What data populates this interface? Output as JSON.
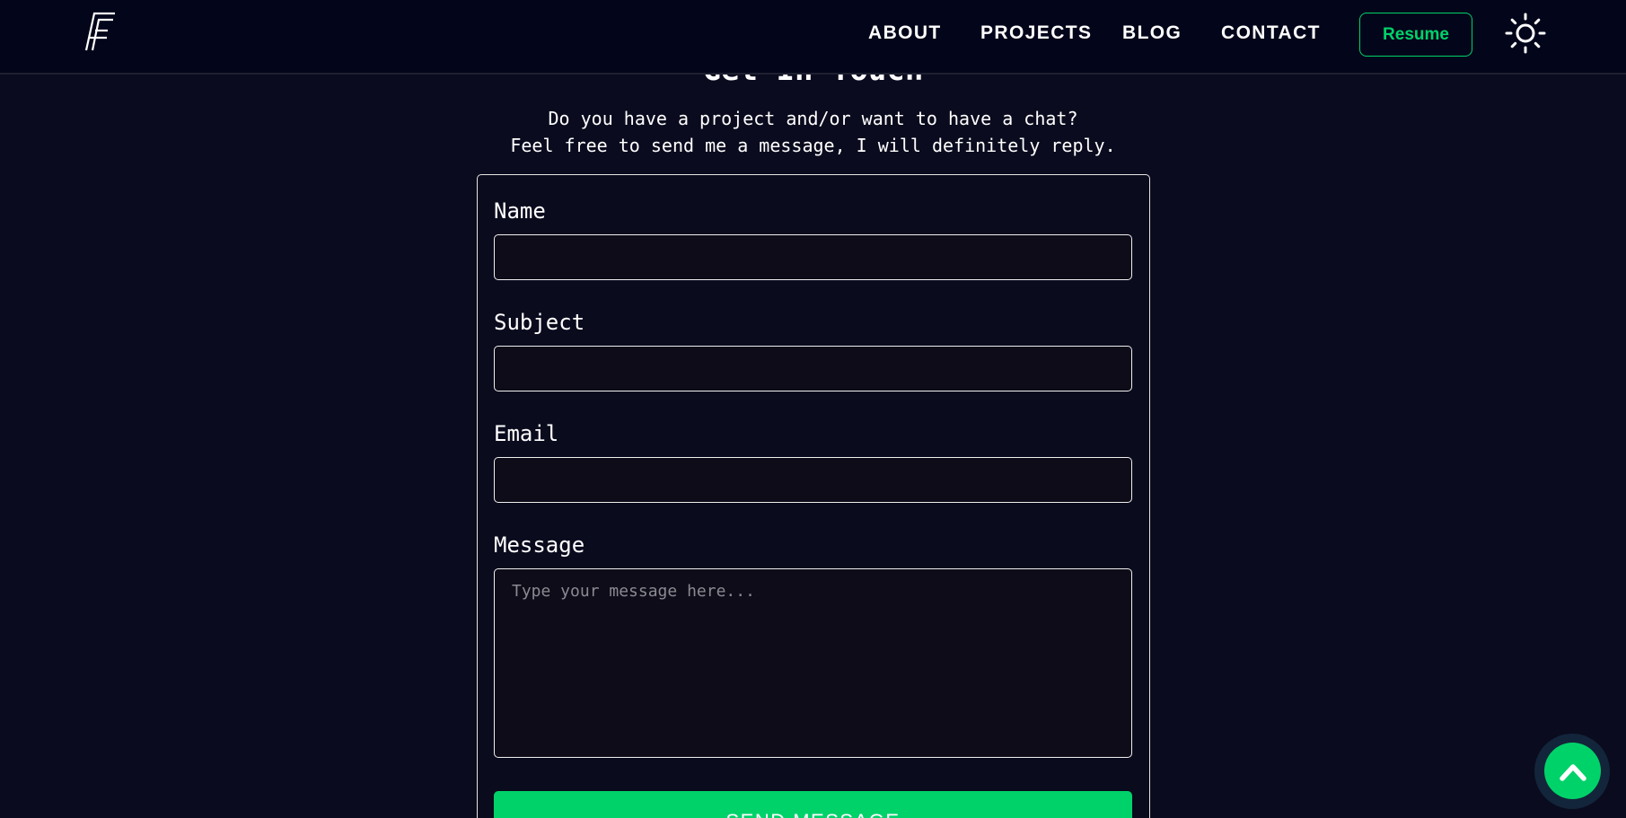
{
  "brand": {
    "logo_icon": "ff-logo-icon"
  },
  "nav": {
    "items": [
      {
        "label": "ABOUT"
      },
      {
        "label": "PROJECTS"
      },
      {
        "label": "BLOG"
      },
      {
        "label": "CONTACT"
      }
    ],
    "resume_label": "Resume",
    "theme_icon": "sun-icon"
  },
  "contact": {
    "heading": "Get In Touch",
    "intro_line1": "Do you have a project and/or want to have a chat?",
    "intro_line2": "Feel free to send me a message, I will definitely reply.",
    "fields": {
      "name_label": "Name",
      "name_value": "",
      "subject_label": "Subject",
      "subject_value": "",
      "email_label": "Email",
      "email_value": "",
      "message_label": "Message",
      "message_placeholder": "Type your message here..."
    },
    "send_label": "SEND MESSAGE"
  },
  "scroll_top": {
    "icon": "chevron-up-icon"
  },
  "colors": {
    "background": "#0a0b1e",
    "header": "#03051a",
    "accent": "#00d26a"
  }
}
